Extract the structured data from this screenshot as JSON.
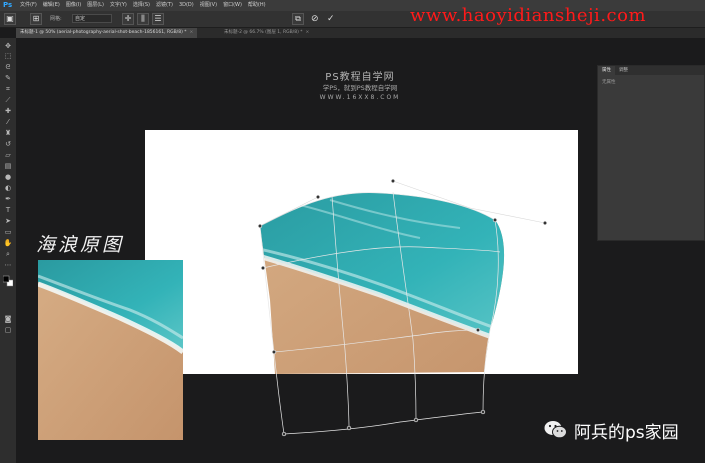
{
  "app": {
    "logo_text": "Ps"
  },
  "menu": [
    "文件(F)",
    "编辑(E)",
    "图像(I)",
    "图层(L)",
    "文字(Y)",
    "选择(S)",
    "滤镜(T)",
    "3D(D)",
    "视图(V)",
    "窗口(W)",
    "帮助(H)"
  ],
  "options_bar": {
    "grid_label": "网格:",
    "grid_value": "自定",
    "confirm_symbol": "✓",
    "cancel_symbol": "⊘"
  },
  "watermark_url": "www.haoyidiansheji.com",
  "tabs": [
    {
      "label": "未标题-1 @ 50% (aerial-photography-aerial-shot-beach-1856161, RGB/8) *",
      "close": "×"
    },
    {
      "label": "未标题-2 @ 66.7% (图层 1, RGB/8) *",
      "close": "×"
    }
  ],
  "site_watermark": {
    "title": "PS教程自学网",
    "subtitle": "学PS，就到PS教程自学网",
    "url": "WWW.16XX8.COM"
  },
  "annotation": "海浪原图",
  "panel": {
    "tabs": [
      "属性",
      "调整"
    ],
    "body": "无属性"
  },
  "brand": {
    "text": "阿兵的ps家园"
  },
  "colors": {
    "bg": "#1b1b1c",
    "accent_watermark": "#ff1a1a",
    "ps_blue": "#31a8ff"
  },
  "icons": [
    "move-icon",
    "marquee-icon",
    "lasso-icon",
    "quick-select-icon",
    "crop-icon",
    "eyedropper-icon",
    "healing-icon",
    "brush-icon",
    "stamp-icon",
    "history-brush-icon",
    "eraser-icon",
    "gradient-icon",
    "blur-icon",
    "dodge-icon",
    "pen-icon",
    "type-icon",
    "path-select-icon",
    "shape-icon",
    "hand-icon",
    "zoom-icon",
    "more-icon",
    "color-swatch-icon",
    "quickmask-icon",
    "screen-mode-icon"
  ]
}
